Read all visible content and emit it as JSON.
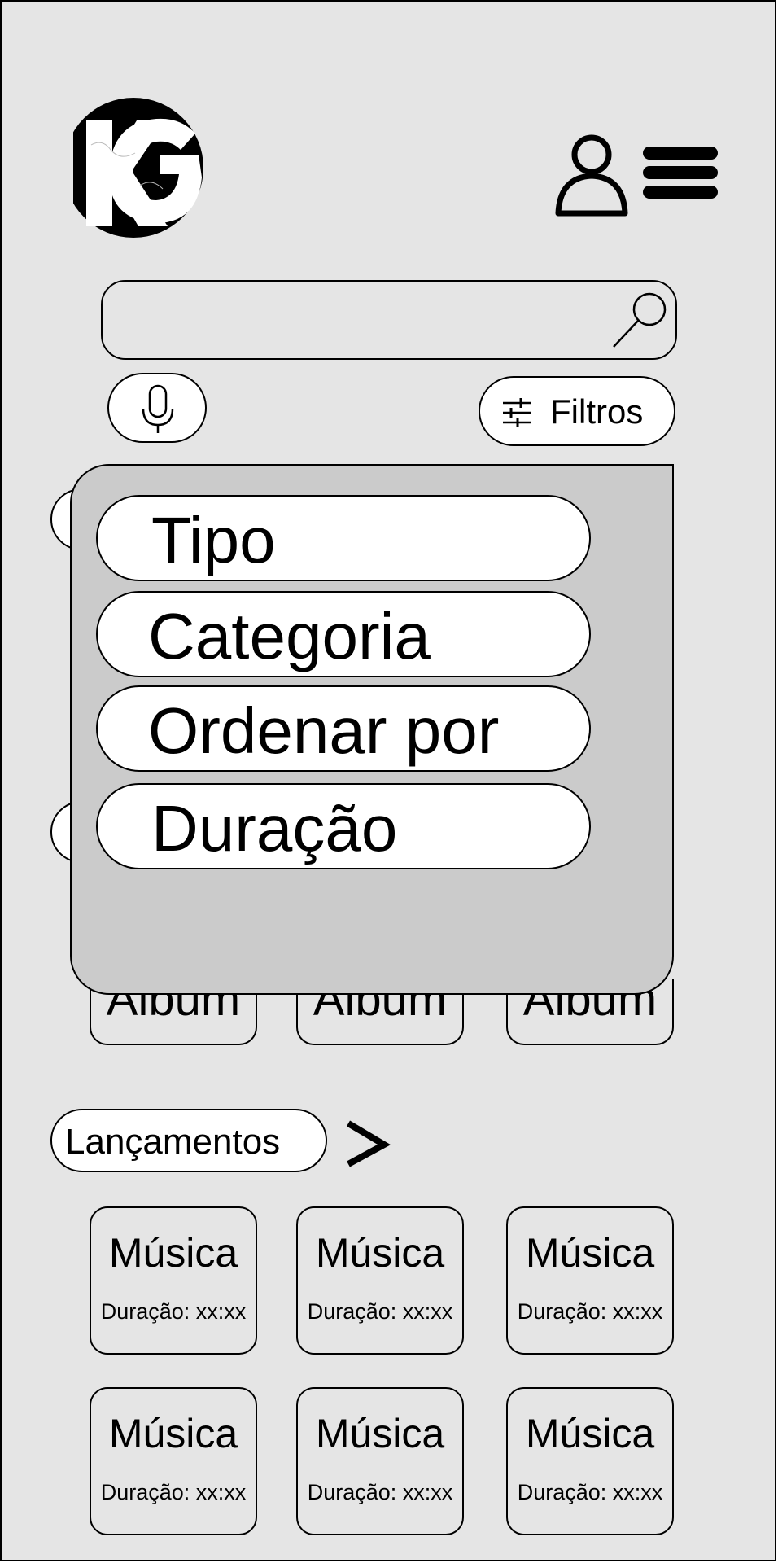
{
  "header": {
    "logo_text": "KG",
    "profile_icon": "user-icon",
    "menu_icon": "hamburger-menu-icon"
  },
  "search": {
    "placeholder": "",
    "value": "",
    "icon": "search-icon"
  },
  "voice": {
    "icon": "microphone-icon"
  },
  "filters": {
    "label": "Filtros",
    "icon": "sliders-icon"
  },
  "filter_menu": {
    "items": [
      {
        "label": "Tipo"
      },
      {
        "label": "Categoria"
      },
      {
        "label": "Ordenar por"
      },
      {
        "label": "Duração"
      }
    ]
  },
  "albums": {
    "items": [
      {
        "label": "Album"
      },
      {
        "label": "Album"
      },
      {
        "label": "Album"
      }
    ]
  },
  "releases": {
    "title": "Lançamentos",
    "arrow": ">",
    "items": [
      {
        "title": "Música",
        "duration": "Duração: xx:xx"
      },
      {
        "title": "Música",
        "duration": "Duração: xx:xx"
      },
      {
        "title": "Música",
        "duration": "Duração: xx:xx"
      },
      {
        "title": "Música",
        "duration": "Duração: xx:xx"
      },
      {
        "title": "Música",
        "duration": "Duração: xx:xx"
      },
      {
        "title": "Música",
        "duration": "Duração: xx:xx"
      }
    ]
  }
}
